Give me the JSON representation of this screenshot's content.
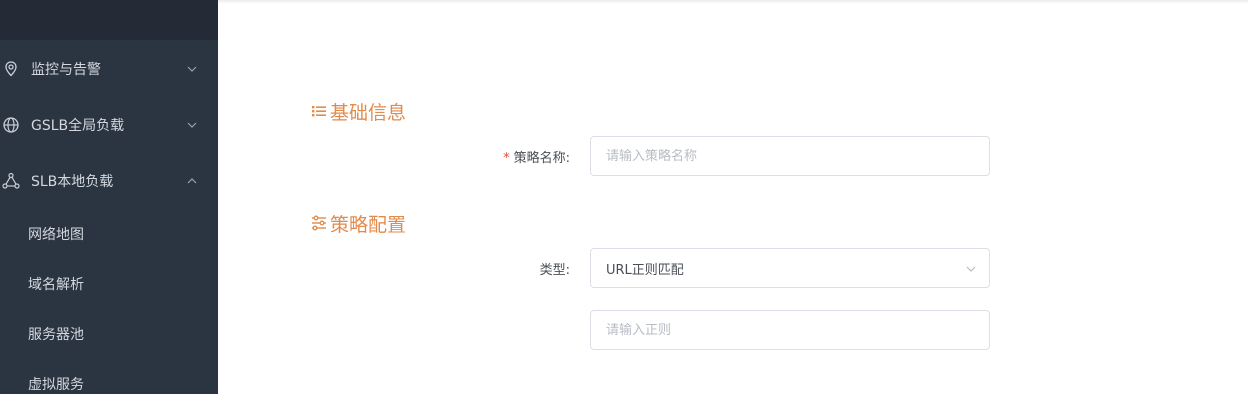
{
  "sidebar": {
    "groups": [
      {
        "label": "监控与告警",
        "icon": "location-pin-icon",
        "expanded": false
      },
      {
        "label": "GSLB全局负载",
        "icon": "globe-icon",
        "expanded": false
      },
      {
        "label": "SLB本地负载",
        "icon": "network-nodes-icon",
        "expanded": true
      }
    ],
    "sub_items": [
      {
        "label": "网络地图"
      },
      {
        "label": "域名解析"
      },
      {
        "label": "服务器池"
      },
      {
        "label": "虚拟服务"
      }
    ]
  },
  "form": {
    "section_basic": {
      "title": "基础信息",
      "icon": "list-icon"
    },
    "policy_name": {
      "required_mark": "*",
      "label": "策略名称:",
      "placeholder": "请输入策略名称",
      "value": ""
    },
    "section_config": {
      "title": "策略配置",
      "icon": "sliders-icon"
    },
    "type": {
      "label": "类型:",
      "selected": "URL正则匹配"
    },
    "regex": {
      "placeholder": "请输入正则",
      "value": ""
    }
  },
  "colors": {
    "sidebar_bg": "#2b3441",
    "sidebar_top_bg": "#242b36",
    "accent": "#e28b4c",
    "required": "#e8463d"
  }
}
